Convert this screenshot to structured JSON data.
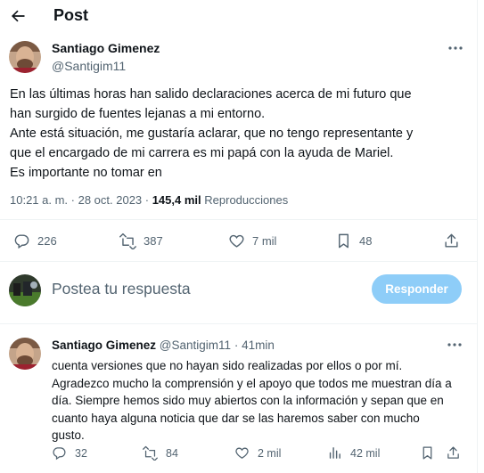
{
  "header": {
    "title": "Post"
  },
  "tweet": {
    "author_name": "Santiago Gimenez",
    "author_handle": "@Santigim11",
    "text": "En las últimas horas han salido declaraciones acerca de mi futuro que\nhan surgido de fuentes lejanas a mi entorno.\nAnte está situación, me gustaría aclarar, que no tengo representante y\nque el encargado de mi carrera es mi papá con la ayuda de Mariel.\nEs importante no tomar en",
    "time": "10:21 a. m. · 28 oct. 2023 · ",
    "views_count": "145,4 mil",
    "views_label": "Reproducciones",
    "stats": {
      "replies": "226",
      "retweets": "387",
      "likes": "7 mil",
      "bookmarks": "48"
    }
  },
  "composer": {
    "placeholder": "Postea tu respuesta",
    "button_label": "Responder"
  },
  "reply": {
    "author_name": "Santiago Gimenez",
    "author_handle": "@Santigim11",
    "time_sep": "·",
    "time": "41min",
    "text": "cuenta versiones que no hayan sido realizadas por ellos o por mí.\nAgradezco mucho la comprensión y el apoyo que todos me muestran día a\ndía. Siempre hemos sido muy abiertos con la información y sepan que en\ncuanto haya alguna noticia que dar se las haremos saber con mucho\ngusto.",
    "stats": {
      "replies": "32",
      "retweets": "84",
      "likes": "2 mil",
      "views": "42 mil"
    }
  },
  "colors": {
    "accent_disabled": "#8ecdf8",
    "secondary_text": "#536471",
    "divider": "#eff3f4"
  }
}
